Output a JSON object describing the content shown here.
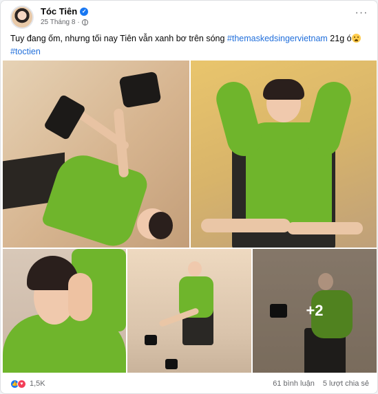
{
  "post": {
    "author": "Tóc Tiên",
    "date": "25 Tháng 8",
    "caption_text": "Tuy đang ốm, nhưng tối nay Tiên vẫn xanh bơ trên sóng ",
    "hashtag_1": "#themaskedsingervietnam",
    "caption_suffix": " 21g ó",
    "hashtag_2": "#toctien"
  },
  "photos": {
    "more_count": "+2"
  },
  "footer": {
    "reactions": "1,5K",
    "comments": "61 bình luận",
    "shares": "5 lượt chia sẻ"
  },
  "colors": {
    "brand_blue": "#1877f2",
    "link_blue": "#216fdb",
    "outfit_green": "#6fb52c",
    "love_red": "#f33e58"
  },
  "icons": [
    "verified-icon",
    "globe-icon",
    "more-options-icon",
    "emoji-icon",
    "like-reaction-icon",
    "love-reaction-icon"
  ]
}
